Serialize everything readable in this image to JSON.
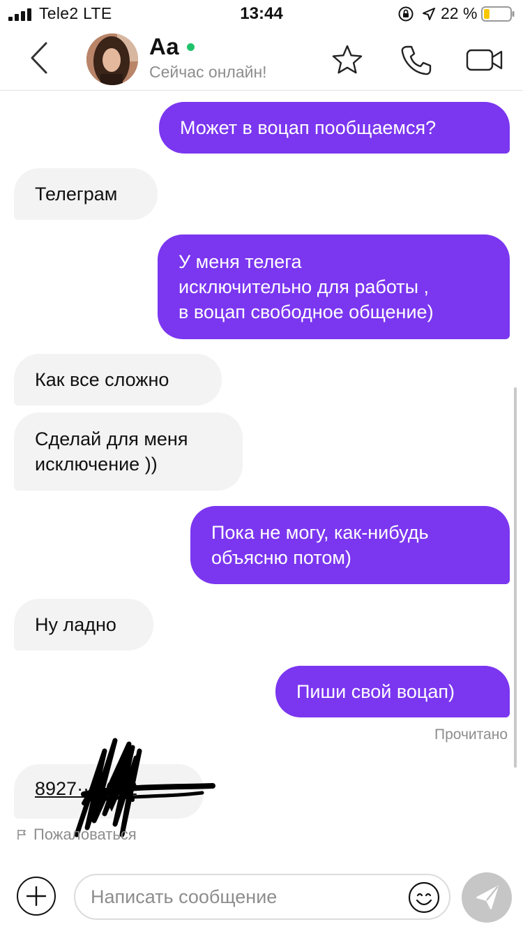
{
  "status_bar": {
    "carrier": "Tele2  LTE",
    "time": "13:44",
    "battery": "22 %",
    "battery_level": 0.22,
    "battery_color": "#f7c700"
  },
  "header": {
    "back_icon": "chevron-left-icon",
    "contact_name": "Аа",
    "status": "Сейчас онлайн!",
    "online_color": "#1fc36b",
    "icons": [
      "star-icon",
      "phone-icon",
      "video-camera-icon"
    ]
  },
  "messages": [
    {
      "direction": "out",
      "lines": [
        "Может в воцап пообщаемся?"
      ]
    },
    {
      "direction": "in",
      "lines": [
        "Телеграм"
      ]
    },
    {
      "direction": "out",
      "lines": [
        "У меня телега",
        "исключительно для работы ,",
        "в воцап свободное общение)"
      ]
    },
    {
      "direction": "in",
      "lines": [
        "Как все сложно"
      ]
    },
    {
      "direction": "in",
      "lines": [
        "Сделай для меня",
        "исключение ))"
      ]
    },
    {
      "direction": "out",
      "lines": [
        "Пока не могу, как-нибудь",
        "объясню потом)"
      ]
    },
    {
      "direction": "in",
      "lines": [
        "Ну ладно"
      ]
    },
    {
      "direction": "out",
      "lines": [
        "Пиши свой воцап)"
      ]
    }
  ],
  "read_status": "Прочитано",
  "phone_message": {
    "text": "8927···0042"
  },
  "report": {
    "label": "Пожаловаться",
    "icon": "flag-icon"
  },
  "input": {
    "placeholder": "Написать сообщение",
    "plus_icon": "plus-icon",
    "emoji_icon": "smile-icon",
    "send_icon": "send-icon"
  },
  "colors": {
    "outgoing_bubble": "#7b36f0",
    "incoming_bubble": "#f3f3f3",
    "send_button": "#c6c6c6"
  }
}
